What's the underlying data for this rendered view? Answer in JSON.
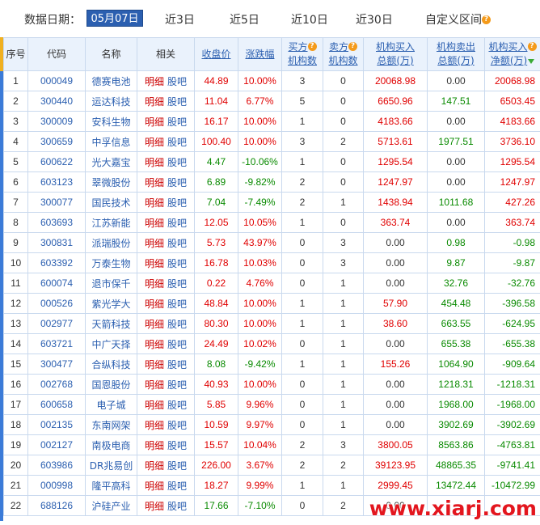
{
  "filter": {
    "label": "数据日期：",
    "selected_date": "05月07日",
    "ranges": [
      "近3日",
      "近5日",
      "近10日",
      "近30日"
    ],
    "custom": "自定义区间",
    "help_glyph": "?"
  },
  "table": {
    "headers": {
      "idx": "序号",
      "code": "代码",
      "name": "名称",
      "related": "相关",
      "close": "收盘价",
      "change": "涨跌幅",
      "buy_count_1": "买方",
      "buy_count_2": "机构数",
      "sell_count_1": "卖方",
      "sell_count_2": "机构数",
      "buy_amt_1": "机构买入",
      "buy_amt_2": "总额(万)",
      "sell_amt_1": "机构卖出",
      "sell_amt_2": "总额(万)",
      "net_1": "机构买入",
      "net_2": "净额(万)"
    },
    "related_detail": "明细",
    "related_bar": "股吧",
    "rows": [
      {
        "idx": "1",
        "code": "000049",
        "name": "德赛电池",
        "close": "44.89",
        "change": "10.00%",
        "dir": "up",
        "buys": "3",
        "sells": "0",
        "buy_amt": "20068.98",
        "sell_amt": "0.00",
        "net": "20068.98"
      },
      {
        "idx": "2",
        "code": "300440",
        "name": "运达科技",
        "close": "11.04",
        "change": "6.77%",
        "dir": "up",
        "buys": "5",
        "sells": "0",
        "buy_amt": "6650.96",
        "sell_amt": "147.51",
        "net": "6503.45"
      },
      {
        "idx": "3",
        "code": "300009",
        "name": "安科生物",
        "close": "16.17",
        "change": "10.00%",
        "dir": "up",
        "buys": "1",
        "sells": "0",
        "buy_amt": "4183.66",
        "sell_amt": "0.00",
        "net": "4183.66"
      },
      {
        "idx": "4",
        "code": "300659",
        "name": "中孚信息",
        "close": "100.40",
        "change": "10.00%",
        "dir": "up",
        "buys": "3",
        "sells": "2",
        "buy_amt": "5713.61",
        "sell_amt": "1977.51",
        "net": "3736.10"
      },
      {
        "idx": "5",
        "code": "600622",
        "name": "光大嘉宝",
        "close": "4.47",
        "change": "-10.06%",
        "dir": "down",
        "buys": "1",
        "sells": "0",
        "buy_amt": "1295.54",
        "sell_amt": "0.00",
        "net": "1295.54"
      },
      {
        "idx": "6",
        "code": "603123",
        "name": "翠微股份",
        "close": "6.89",
        "change": "-9.82%",
        "dir": "down",
        "buys": "2",
        "sells": "0",
        "buy_amt": "1247.97",
        "sell_amt": "0.00",
        "net": "1247.97"
      },
      {
        "idx": "7",
        "code": "300077",
        "name": "国民技术",
        "close": "7.04",
        "change": "-7.49%",
        "dir": "down",
        "buys": "2",
        "sells": "1",
        "buy_amt": "1438.94",
        "sell_amt": "1011.68",
        "net": "427.26"
      },
      {
        "idx": "8",
        "code": "603693",
        "name": "江苏新能",
        "close": "12.05",
        "change": "10.05%",
        "dir": "up",
        "buys": "1",
        "sells": "0",
        "buy_amt": "363.74",
        "sell_amt": "0.00",
        "net": "363.74"
      },
      {
        "idx": "9",
        "code": "300831",
        "name": "派瑞股份",
        "close": "5.73",
        "change": "43.97%",
        "dir": "up",
        "buys": "0",
        "sells": "3",
        "buy_amt": "0.00",
        "sell_amt": "0.98",
        "net": "-0.98"
      },
      {
        "idx": "10",
        "code": "603392",
        "name": "万泰生物",
        "close": "16.78",
        "change": "10.03%",
        "dir": "up",
        "buys": "0",
        "sells": "3",
        "buy_amt": "0.00",
        "sell_amt": "9.87",
        "net": "-9.87"
      },
      {
        "idx": "11",
        "code": "600074",
        "name": "退市保千",
        "close": "0.22",
        "change": "4.76%",
        "dir": "up",
        "buys": "0",
        "sells": "1",
        "buy_amt": "0.00",
        "sell_amt": "32.76",
        "net": "-32.76"
      },
      {
        "idx": "12",
        "code": "000526",
        "name": "紫光学大",
        "close": "48.84",
        "change": "10.00%",
        "dir": "up",
        "buys": "1",
        "sells": "1",
        "buy_amt": "57.90",
        "sell_amt": "454.48",
        "net": "-396.58"
      },
      {
        "idx": "13",
        "code": "002977",
        "name": "天箭科技",
        "close": "80.30",
        "change": "10.00%",
        "dir": "up",
        "buys": "1",
        "sells": "1",
        "buy_amt": "38.60",
        "sell_amt": "663.55",
        "net": "-624.95"
      },
      {
        "idx": "14",
        "code": "603721",
        "name": "中广天择",
        "close": "24.49",
        "change": "10.02%",
        "dir": "up",
        "buys": "0",
        "sells": "1",
        "buy_amt": "0.00",
        "sell_amt": "655.38",
        "net": "-655.38"
      },
      {
        "idx": "15",
        "code": "300477",
        "name": "合纵科技",
        "close": "8.08",
        "change": "-9.42%",
        "dir": "down",
        "buys": "1",
        "sells": "1",
        "buy_amt": "155.26",
        "sell_amt": "1064.90",
        "net": "-909.64"
      },
      {
        "idx": "16",
        "code": "002768",
        "name": "国恩股份",
        "close": "40.93",
        "change": "10.00%",
        "dir": "up",
        "buys": "0",
        "sells": "1",
        "buy_amt": "0.00",
        "sell_amt": "1218.31",
        "net": "-1218.31"
      },
      {
        "idx": "17",
        "code": "600658",
        "name": "电子城",
        "close": "5.85",
        "change": "9.96%",
        "dir": "up",
        "buys": "0",
        "sells": "1",
        "buy_amt": "0.00",
        "sell_amt": "1968.00",
        "net": "-1968.00"
      },
      {
        "idx": "18",
        "code": "002135",
        "name": "东南网架",
        "close": "10.59",
        "change": "9.97%",
        "dir": "up",
        "buys": "0",
        "sells": "1",
        "buy_amt": "0.00",
        "sell_amt": "3902.69",
        "net": "-3902.69"
      },
      {
        "idx": "19",
        "code": "002127",
        "name": "南极电商",
        "close": "15.57",
        "change": "10.04%",
        "dir": "up",
        "buys": "2",
        "sells": "3",
        "buy_amt": "3800.05",
        "sell_amt": "8563.86",
        "net": "-4763.81"
      },
      {
        "idx": "20",
        "code": "603986",
        "name": "DR兆易创",
        "close": "226.00",
        "change": "3.67%",
        "dir": "up",
        "buys": "2",
        "sells": "2",
        "buy_amt": "39123.95",
        "sell_amt": "48865.35",
        "net": "-9741.41"
      },
      {
        "idx": "21",
        "code": "000998",
        "name": "隆平高科",
        "close": "18.27",
        "change": "9.99%",
        "dir": "up",
        "buys": "1",
        "sells": "1",
        "buy_amt": "2999.45",
        "sell_amt": "13472.44",
        "net": "-10472.99"
      },
      {
        "idx": "22",
        "code": "688126",
        "name": "沪硅产业",
        "close": "17.66",
        "change": "-7.10%",
        "dir": "down",
        "buys": "0",
        "sells": "2",
        "buy_amt": "0.00",
        "sell_amt": "",
        "net": ""
      }
    ]
  },
  "watermark": "www.xiarj.com",
  "colors": {
    "up": "#e00000",
    "down": "#098a00",
    "link": "#2b5fb0",
    "header_bg": "#eaf2fc",
    "border": "#c9d9ee",
    "help_badge": "#f49a1a"
  }
}
